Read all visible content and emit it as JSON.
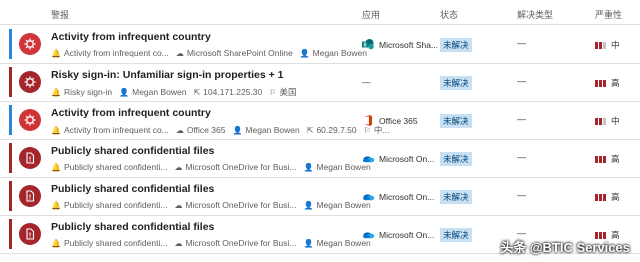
{
  "header": {
    "alert": "警报",
    "app": "应用",
    "status": "状态",
    "resolution": "解决类型",
    "severity": "严重性"
  },
  "colors": {
    "high_stripe": "#a4262c",
    "medium_stripe": "#2b88d8",
    "alert_circle_medium": "#d13438",
    "alert_circle_high": "#a4262c",
    "status_bg": "#c7e0f4",
    "sev_red": "#a4262c",
    "sev_gray": "#c8c6c4"
  },
  "rows": [
    {
      "severity_level": "medium",
      "icon": "gear-alert-icon",
      "title": "Activity from infrequent country",
      "meta": [
        {
          "icon": "alert-icon",
          "text": "Activity from infrequent co..."
        },
        {
          "icon": "cloud-icon",
          "text": "Microsoft SharePoint Online"
        },
        {
          "icon": "person-icon",
          "text": "Megan Bowen"
        }
      ],
      "app": {
        "icon": "sharepoint-icon",
        "label": "Microsoft Sha..."
      },
      "status": "未解决",
      "resolution": "—",
      "severity": "中",
      "severity_bars": 2
    },
    {
      "severity_level": "high",
      "icon": "gear-alert-icon",
      "title": "Risky sign-in: Unfamiliar sign-in properties + 1",
      "meta": [
        {
          "icon": "alert-icon",
          "text": "Risky sign-in"
        },
        {
          "icon": "person-icon",
          "text": "Megan Bowen"
        },
        {
          "icon": "ip-icon",
          "text": "104.171.225.30"
        },
        {
          "icon": "flag-icon",
          "text": "美国"
        }
      ],
      "app": {
        "icon": "",
        "label": "—"
      },
      "status": "未解决",
      "resolution": "—",
      "severity": "高",
      "severity_bars": 3
    },
    {
      "severity_level": "medium",
      "icon": "gear-alert-icon",
      "title": "Activity from infrequent country",
      "meta": [
        {
          "icon": "alert-icon",
          "text": "Activity from infrequent co..."
        },
        {
          "icon": "cloud-icon",
          "text": "Office 365"
        },
        {
          "icon": "person-icon",
          "text": "Megan Bowen"
        },
        {
          "icon": "ip-icon",
          "text": "60.29.7.50"
        },
        {
          "icon": "flag-icon",
          "text": "中..."
        }
      ],
      "app": {
        "icon": "office-icon",
        "label": "Office 365"
      },
      "status": "未解决",
      "resolution": "—",
      "severity": "中",
      "severity_bars": 2
    },
    {
      "severity_level": "high",
      "icon": "file-alert-icon",
      "title": "Publicly shared confidential files",
      "meta": [
        {
          "icon": "alert-icon",
          "text": "Publicly shared confidenti..."
        },
        {
          "icon": "cloud-icon",
          "text": "Microsoft OneDrive for Busi..."
        },
        {
          "icon": "person-icon",
          "text": "Megan Bowen"
        }
      ],
      "app": {
        "icon": "onedrive-icon",
        "label": "Microsoft On..."
      },
      "status": "未解决",
      "resolution": "—",
      "severity": "高",
      "severity_bars": 3
    },
    {
      "severity_level": "high",
      "icon": "file-alert-icon",
      "title": "Publicly shared confidential files",
      "meta": [
        {
          "icon": "alert-icon",
          "text": "Publicly shared confidenti..."
        },
        {
          "icon": "cloud-icon",
          "text": "Microsoft OneDrive for Busi..."
        },
        {
          "icon": "person-icon",
          "text": "Megan Bowen"
        }
      ],
      "app": {
        "icon": "onedrive-icon",
        "label": "Microsoft On..."
      },
      "status": "未解决",
      "resolution": "—",
      "severity": "高",
      "severity_bars": 3
    },
    {
      "severity_level": "high",
      "icon": "file-alert-icon",
      "title": "Publicly shared confidential files",
      "meta": [
        {
          "icon": "alert-icon",
          "text": "Publicly shared confidenti..."
        },
        {
          "icon": "cloud-icon",
          "text": "Microsoft OneDrive for Busi..."
        },
        {
          "icon": "person-icon",
          "text": "Megan Bowen"
        }
      ],
      "app": {
        "icon": "onedrive-icon",
        "label": "Microsoft On..."
      },
      "status": "未解决",
      "resolution": "—",
      "severity": "高",
      "severity_bars": 3
    }
  ],
  "watermark": "头条 @BTIC Services"
}
